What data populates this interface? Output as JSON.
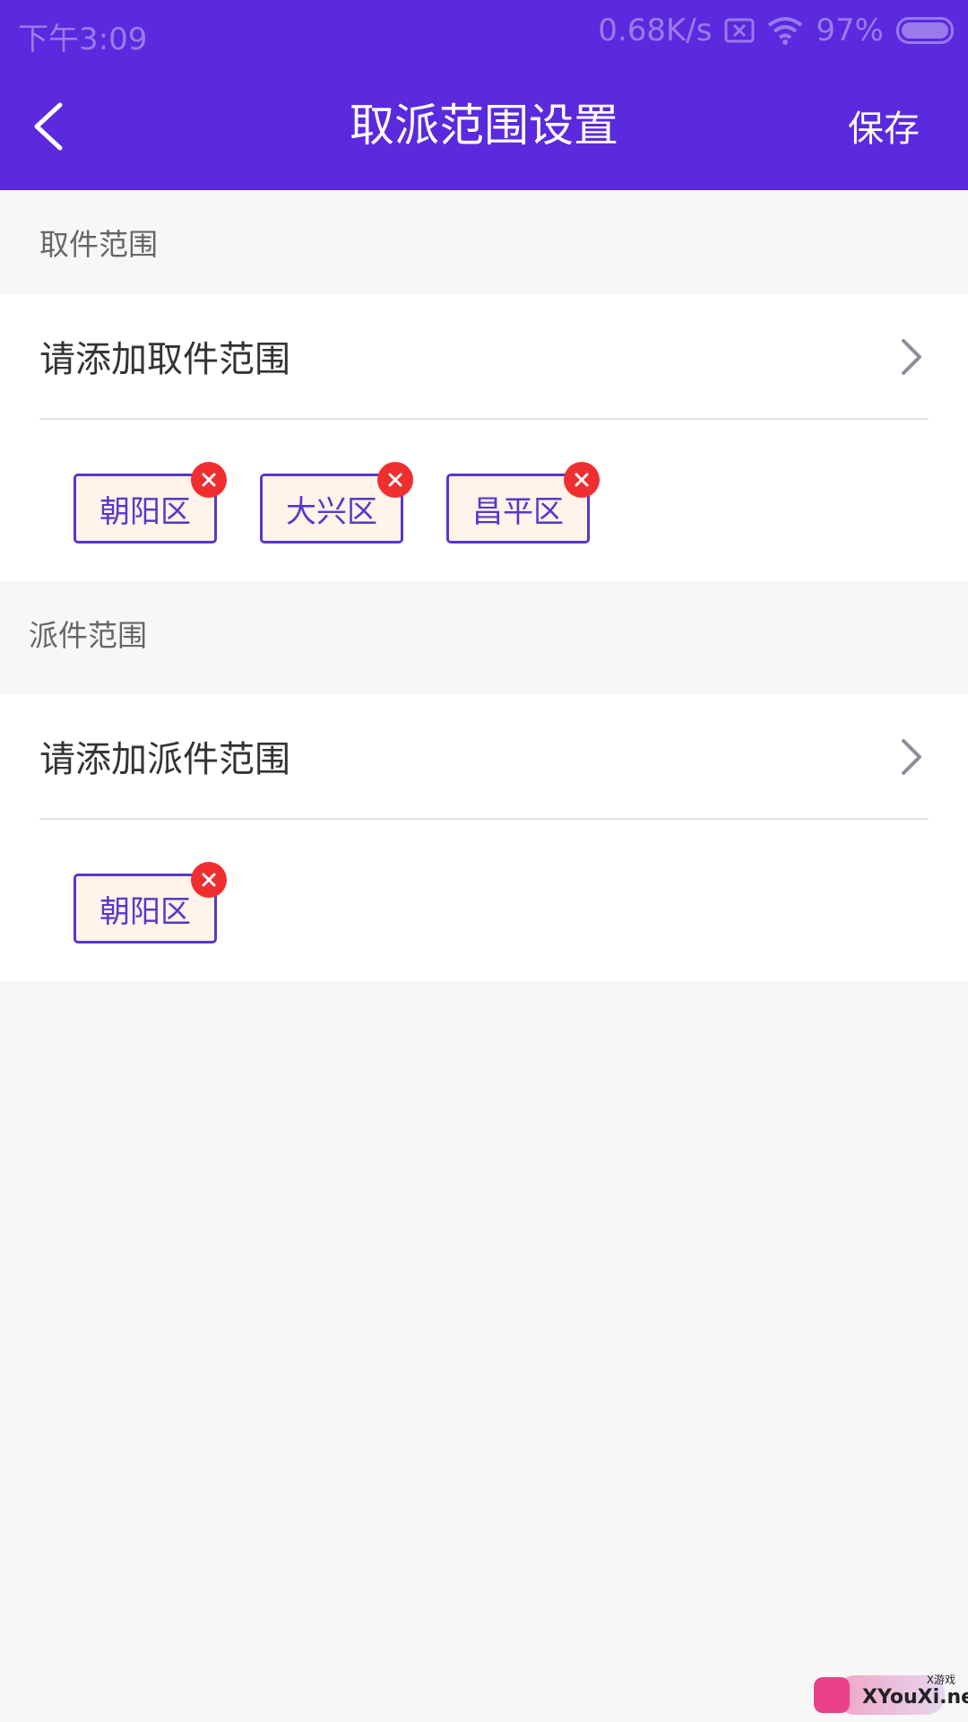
{
  "status_bar": {
    "time": "下午3:09",
    "net_speed": "0.68K/s",
    "battery": "97%"
  },
  "header": {
    "title": "取派范围设置",
    "save_label": "保存"
  },
  "pickup": {
    "section_title": "取件范围",
    "add_label": "请添加取件范围",
    "tags": [
      "朝阳区",
      "大兴区",
      "昌平区"
    ]
  },
  "dispatch": {
    "section_title": "派件范围",
    "add_label": "请添加派件范围",
    "tags": [
      "朝阳区"
    ]
  },
  "watermark": {
    "text": "XYouXi.net",
    "small": "X游戏"
  },
  "colors": {
    "primary": "#5b29de",
    "tag_border": "#5a36c9",
    "tag_bg": "#fff3ea",
    "remove": "#ef2f2f"
  }
}
